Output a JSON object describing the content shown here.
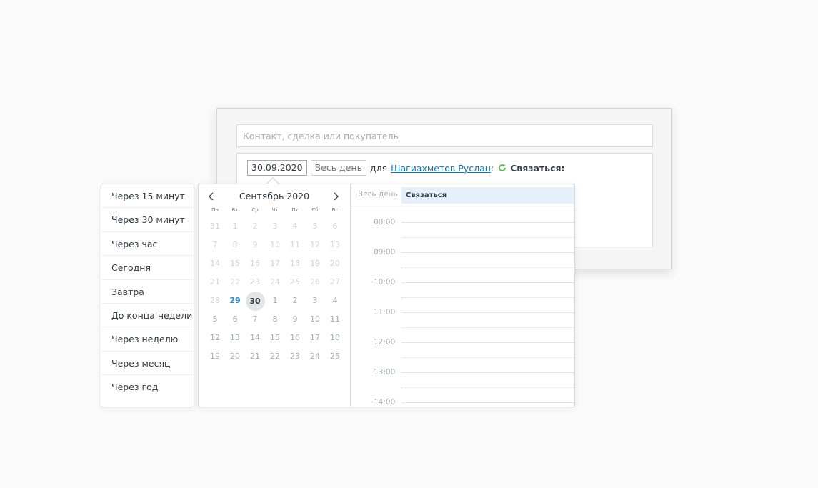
{
  "search": {
    "placeholder": "Контакт, сделка или покупатель"
  },
  "task": {
    "date": "30.09.2020",
    "allday_label": "Весь день",
    "for_text": "для",
    "user_name": "Шагиахметов Руслан",
    "colon": ":",
    "action_label": "Связаться:"
  },
  "quick_periods": [
    "Через 15 минут",
    "Через 30 минут",
    "Через час",
    "Сегодня",
    "Завтра",
    "До конца недели",
    "Через неделю",
    "Через месяц",
    "Через год"
  ],
  "calendar": {
    "month_title": "Сентябрь 2020",
    "weekdays": [
      "Пн",
      "Вт",
      "Ср",
      "Чт",
      "Пт",
      "Сб",
      "Вс"
    ],
    "weeks": [
      [
        "31",
        "1",
        "2",
        "3",
        "4",
        "5",
        "6"
      ],
      [
        "7",
        "8",
        "9",
        "10",
        "11",
        "12",
        "13"
      ],
      [
        "14",
        "15",
        "16",
        "17",
        "18",
        "19",
        "20"
      ],
      [
        "21",
        "22",
        "23",
        "24",
        "25",
        "26",
        "27"
      ],
      [
        "28",
        "29",
        "30",
        "1",
        "2",
        "3",
        "4"
      ],
      [
        "5",
        "6",
        "7",
        "8",
        "9",
        "10",
        "11"
      ],
      [
        "12",
        "13",
        "14",
        "15",
        "16",
        "17",
        "18"
      ],
      [
        "19",
        "20",
        "21",
        "22",
        "23",
        "24",
        "25"
      ]
    ],
    "today": "29",
    "selected": "30"
  },
  "timeline": {
    "allday_label": "Весь день",
    "event_label": "Связаться",
    "hours": [
      "08:00",
      "09:00",
      "10:00",
      "11:00",
      "12:00",
      "13:00",
      "14:00"
    ]
  },
  "colors": {
    "link": "#1375ab",
    "today": "#2b88bf",
    "event_bg": "#e5f0fb",
    "refresh_icon": "#5fb85b"
  },
  "icons": {
    "refresh": "refresh-icon",
    "prev": "chevron-left-icon",
    "next": "chevron-right-icon"
  }
}
